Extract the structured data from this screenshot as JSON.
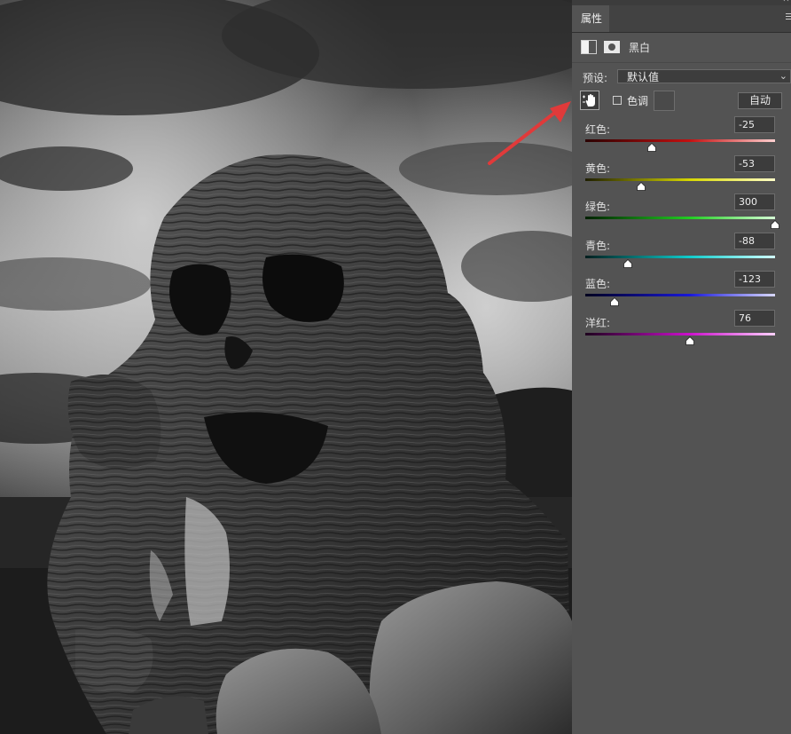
{
  "panel": {
    "tab_label": "属性",
    "adjustment_title": "黑白",
    "preset_label": "预设:",
    "preset_value": "默认值",
    "tint_label": "色调",
    "auto_button": "自动"
  },
  "sliders": [
    {
      "id": "red",
      "label": "红色:",
      "value": "-25",
      "num": -25,
      "from": "#2a0000",
      "mid": "#c41010",
      "to": "#ffd0d0"
    },
    {
      "id": "yellow",
      "label": "黄色:",
      "value": "-53",
      "num": -53,
      "from": "#1e1e00",
      "mid": "#d6d600",
      "to": "#ffffc8"
    },
    {
      "id": "green",
      "label": "绿色:",
      "value": "300",
      "num": 300,
      "from": "#002000",
      "mid": "#22cc22",
      "to": "#d4ffd4"
    },
    {
      "id": "cyan",
      "label": "青色:",
      "value": "-88",
      "num": -88,
      "from": "#001e1e",
      "mid": "#10cccc",
      "to": "#d0ffff"
    },
    {
      "id": "blue",
      "label": "蓝色:",
      "value": "-123",
      "num": -123,
      "from": "#00001e",
      "mid": "#1818d8",
      "to": "#d8d8ff"
    },
    {
      "id": "magenta",
      "label": "洋红:",
      "value": "76",
      "num": 76,
      "from": "#1e001e",
      "mid": "#cc10cc",
      "to": "#ffd0ff"
    }
  ],
  "slider_range": [
    -200,
    300
  ],
  "colors": {
    "panel_bg": "#535353",
    "arrow": "#e03a3a"
  }
}
